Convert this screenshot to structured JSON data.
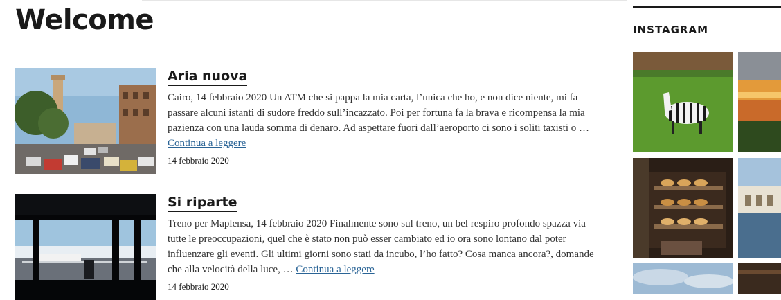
{
  "page": {
    "title": "Welcome"
  },
  "posts": [
    {
      "title": "Aria nuova",
      "excerpt": "Cairo, 14 febbraio 2020 Un ATM che si pappa la mia carta, l’unica che ho, e non dice niente, mi fa passare alcuni istanti di sudore freddo sull’incazzato. Poi per fortuna fa la brava e ricompensa la mia pazienza con una lauda somma di denaro. Ad aspettare fuori dall’aeroporto ci sono i soliti taxisti o …",
      "more_label": "Continua a leggere",
      "date": "14 febbraio 2020"
    },
    {
      "title": "Si riparte",
      "excerpt": "Treno per Maplensa, 14 febbraio 2020 Finalmente sono sul treno, un bel respiro profondo spazza via tutte le preoccupazioni, quel che è stato non può esser cambiato ed io ora sono lontano dal poter influenzare gli eventi. Gli ultimi giorni sono stati da incubo, l’ho fatto? Cosa manca ancora?, domande che alla velocità della luce, …",
      "more_label": "Continua a leggere",
      "date": "14 febbraio 2020"
    }
  ],
  "sidebar": {
    "instagram_title": "INSTAGRAM"
  },
  "colors": {
    "text": "#1a1a1a",
    "link": "#2a6496",
    "rule": "#1a1a1a"
  }
}
